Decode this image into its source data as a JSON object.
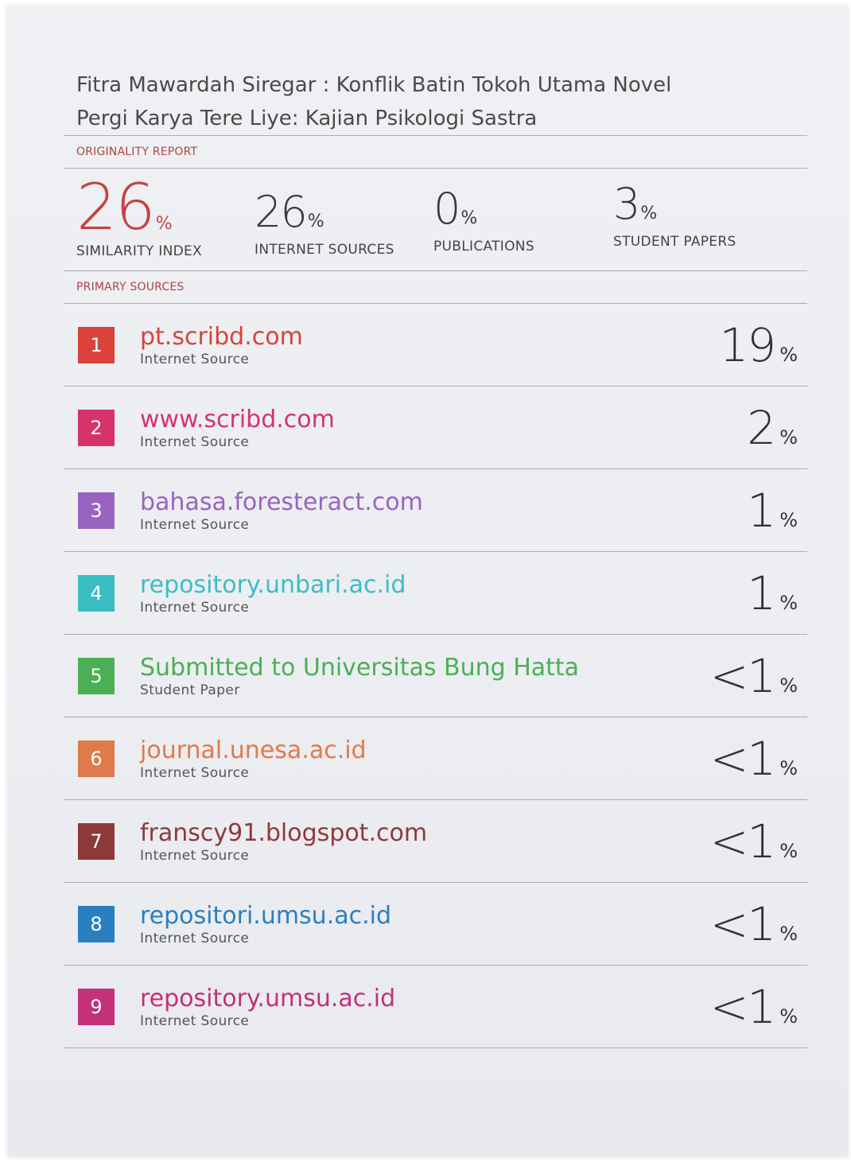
{
  "report": {
    "title_line1": "Fitra Mawardah Siregar : Konflik Batin Tokoh Utama Novel",
    "title_line2": "Pergi Karya Tere Liye: Kajian Psikologi Sastra",
    "originality_label": "ORIGINALITY REPORT",
    "primary_label": "PRIMARY SOURCES"
  },
  "stats": [
    {
      "value": "26",
      "unit": "%",
      "label": "SIMILARITY INDEX"
    },
    {
      "value": "26",
      "unit": "%",
      "label": "INTERNET SOURCES"
    },
    {
      "value": "0",
      "unit": "%",
      "label": "PUBLICATIONS"
    },
    {
      "value": "3",
      "unit": "%",
      "label": "STUDENT PAPERS"
    }
  ],
  "sources": [
    {
      "rank": "1",
      "name": "pt.scribd.com",
      "type": "Internet Source",
      "percent": "19",
      "unit": "%",
      "color": "#d9433b"
    },
    {
      "rank": "2",
      "name": "www.scribd.com",
      "type": "Internet Source",
      "percent": "2",
      "unit": "%",
      "color": "#d6336c"
    },
    {
      "rank": "3",
      "name": "bahasa.foresteract.com",
      "type": "Internet Source",
      "percent": "1",
      "unit": "%",
      "color": "#9b63c0"
    },
    {
      "rank": "4",
      "name": "repository.unbari.ac.id",
      "type": "Internet Source",
      "percent": "1",
      "unit": "%",
      "color": "#3bbdc4"
    },
    {
      "rank": "5",
      "name": "Submitted to Universitas Bung Hatta",
      "type": "Student Paper",
      "percent": "<1",
      "unit": "%",
      "color": "#4caf55"
    },
    {
      "rank": "6",
      "name": "journal.unesa.ac.id",
      "type": "Internet Source",
      "percent": "<1",
      "unit": "%",
      "color": "#e07a4a"
    },
    {
      "rank": "7",
      "name": "franscy91.blogspot.com",
      "type": "Internet Source",
      "percent": "<1",
      "unit": "%",
      "color": "#8e3a3a"
    },
    {
      "rank": "8",
      "name": "repositori.umsu.ac.id",
      "type": "Internet Source",
      "percent": "<1",
      "unit": "%",
      "color": "#2a7fc0"
    },
    {
      "rank": "9",
      "name": "repository.umsu.ac.id",
      "type": "Internet Source",
      "percent": "<1",
      "unit": "%",
      "color": "#c4307a"
    }
  ]
}
